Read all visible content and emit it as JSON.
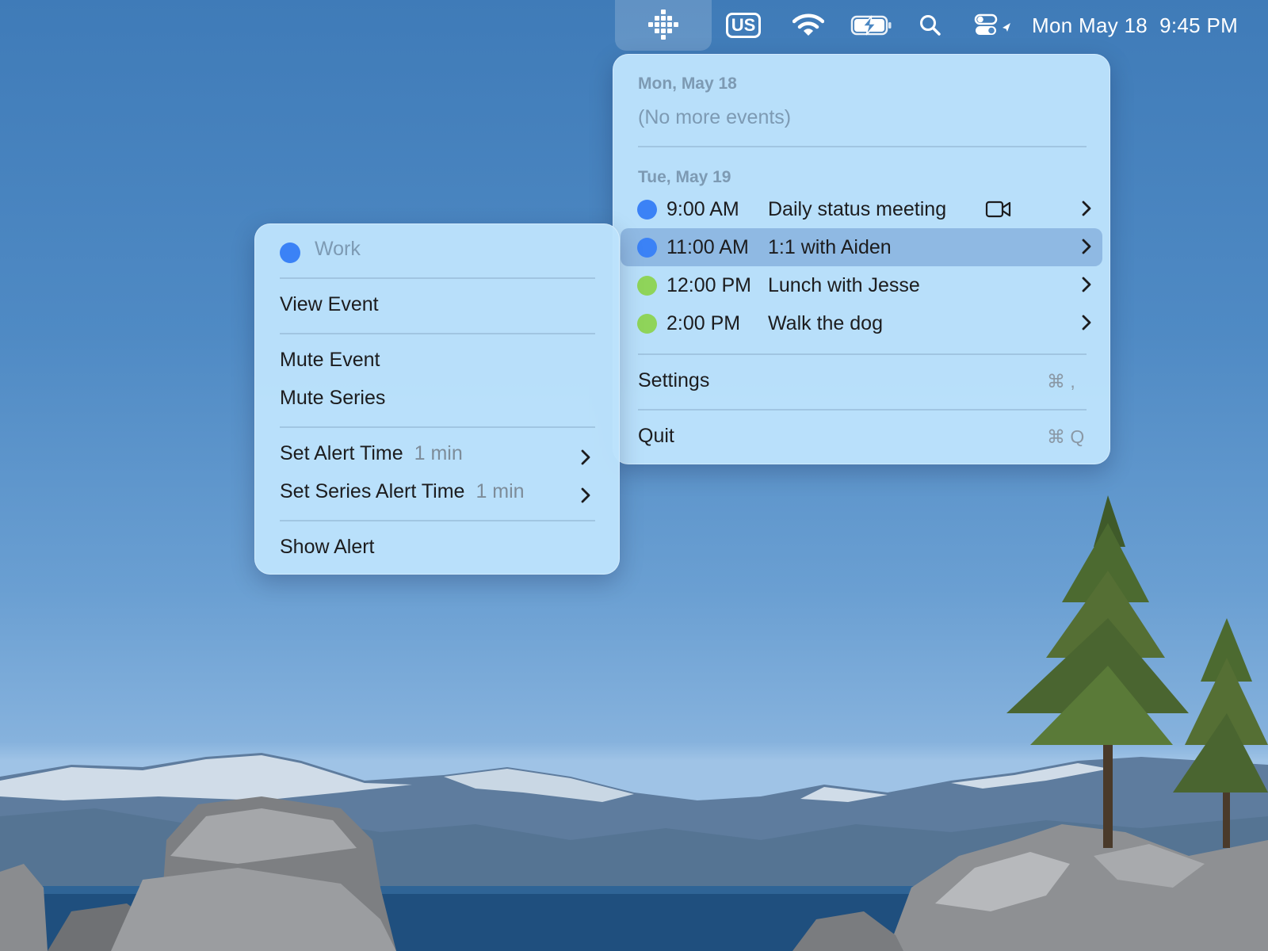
{
  "menubar": {
    "input_source": "US",
    "clock_date": "Mon May 18",
    "clock_time": "9:45 PM"
  },
  "events_menu": {
    "today_header": "Mon, May 18",
    "no_events": "(No more events)",
    "tomorrow_header": "Tue, May 19",
    "events": [
      {
        "time": "9:00 AM",
        "title": "Daily status meeting",
        "color": "#3b82f6",
        "has_video": true
      },
      {
        "time": "11:00 AM",
        "title": "1:1 with Aiden",
        "color": "#3b82f6",
        "highlighted": true
      },
      {
        "time": "12:00 PM",
        "title": "Lunch with Jesse",
        "color": "#8fd45a"
      },
      {
        "time": "2:00 PM",
        "title": "Walk the dog",
        "color": "#8fd45a"
      }
    ],
    "settings_label": "Settings",
    "settings_shortcut": "⌘ ,",
    "quit_label": "Quit",
    "quit_shortcut": "⌘ Q"
  },
  "context_menu": {
    "calendar_name": "Work",
    "calendar_color": "#3b82f6",
    "view_event": "View Event",
    "mute_event": "Mute Event",
    "mute_series": "Mute Series",
    "set_alert_time": "Set Alert Time",
    "set_alert_time_value": "1 min",
    "set_series_alert_time": "Set Series Alert Time",
    "set_series_alert_time_value": "1 min",
    "show_alert": "Show Alert"
  }
}
